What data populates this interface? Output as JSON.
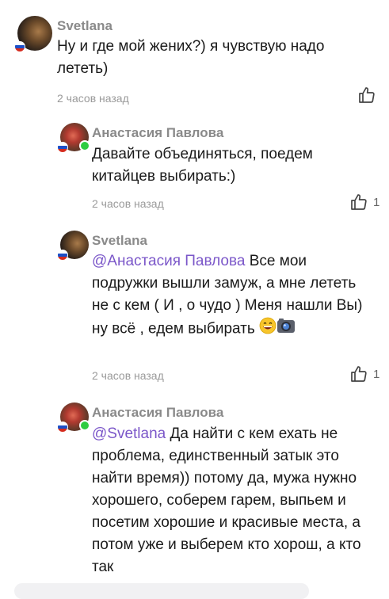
{
  "comments": [
    {
      "author": "Svetlana",
      "text": "Ну и где мой жених?) я чувствую надо лететь)",
      "time": "2 часов назад",
      "likes": ""
    },
    {
      "author": "Анастасия Павлова",
      "text": "Давайте объединяться, поедем китайцев выбирать:)",
      "time": "2 часов назад",
      "likes": "1"
    },
    {
      "author": "Svetlana",
      "mention": "@Анастасия Павлова",
      "text": "Все мои подружки  вышли замуж, а мне лететь не с кем ( И , о чудо ) Меня нашли Вы) ну всё , едем выбирать",
      "time": "2 часов назад",
      "likes": "1"
    },
    {
      "author": "Анастасия Павлова",
      "mention": "@Svetlana",
      "text": "Да найти с кем ехать не проблема, единственный затык это найти время)) потому да, мужа нужно хорошего, соберем гарем, выпьем и посетим хорошие и красивые места, а потом уже и выберем кто хорош, а кто так"
    }
  ],
  "colors": {
    "mention": "#7b57c9",
    "meta": "#9a9a9a",
    "online": "#2ecc40"
  },
  "icons": [
    "thumbs-up-icon",
    "russia-flag-icon",
    "grinning-emoji-icon",
    "camera-emoji-icon"
  ]
}
